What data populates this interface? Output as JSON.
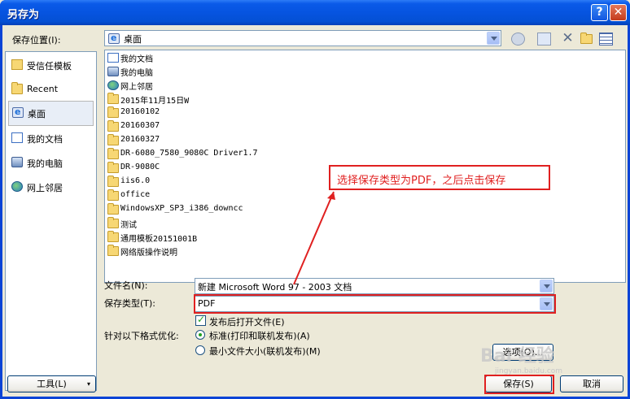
{
  "window": {
    "title": "另存为",
    "help_label": "?",
    "close_label": "✕"
  },
  "save_in": {
    "label": "保存位置(I):",
    "value": "桌面"
  },
  "places": [
    {
      "label": "受信任模板",
      "icon": "trusted-templates-icon"
    },
    {
      "label": "Recent",
      "icon": "folder-icon"
    },
    {
      "label": "桌面",
      "icon": "desktop-icon",
      "selected": true
    },
    {
      "label": "我的文档",
      "icon": "my-documents-icon"
    },
    {
      "label": "我的电脑",
      "icon": "my-computer-icon"
    },
    {
      "label": "网上邻居",
      "icon": "network-icon"
    }
  ],
  "files": [
    {
      "name": "我的文档",
      "icon": "my-documents-icon"
    },
    {
      "name": "我的电脑",
      "icon": "my-computer-icon"
    },
    {
      "name": "网上邻居",
      "icon": "network-icon"
    },
    {
      "name": "2015年11月15日W",
      "icon": "folder-icon"
    },
    {
      "name": "20160102",
      "icon": "folder-icon"
    },
    {
      "name": "20160307",
      "icon": "folder-icon"
    },
    {
      "name": "20160327",
      "icon": "folder-icon"
    },
    {
      "name": "DR-6080_7580_9080C Driver1.7",
      "icon": "folder-icon"
    },
    {
      "name": "DR-9080C",
      "icon": "folder-icon"
    },
    {
      "name": "iis6.0",
      "icon": "folder-icon"
    },
    {
      "name": "office",
      "icon": "folder-icon"
    },
    {
      "name": "WindowsXP_SP3_i386_downcc",
      "icon": "folder-icon"
    },
    {
      "name": "测试",
      "icon": "folder-icon"
    },
    {
      "name": "通用模板20151001B",
      "icon": "folder-icon"
    },
    {
      "name": "网络版操作说明",
      "icon": "folder-icon"
    }
  ],
  "form": {
    "filename_label": "文件名(N):",
    "filename_value": "新建 Microsoft Word 97 - 2003 文档",
    "filetype_label": "保存类型(T):",
    "filetype_value": "PDF",
    "open_after_label": "发布后打开文件(E)",
    "optimize_label": "针对以下格式优化:",
    "opt_standard": "标准(打印和联机发布)(A)",
    "opt_minimum": "最小文件大小(联机发布)(M)",
    "options_button": "选项(O)..."
  },
  "buttons": {
    "tools": "工具(L)",
    "save": "保存(S)",
    "cancel": "取消"
  },
  "annotation": {
    "text": "选择保存类型为PDF，之后点击保存",
    "color": "#e02020"
  },
  "watermark": {
    "text": "Bai 经验",
    "sub": "jingyan.baidu.com"
  }
}
